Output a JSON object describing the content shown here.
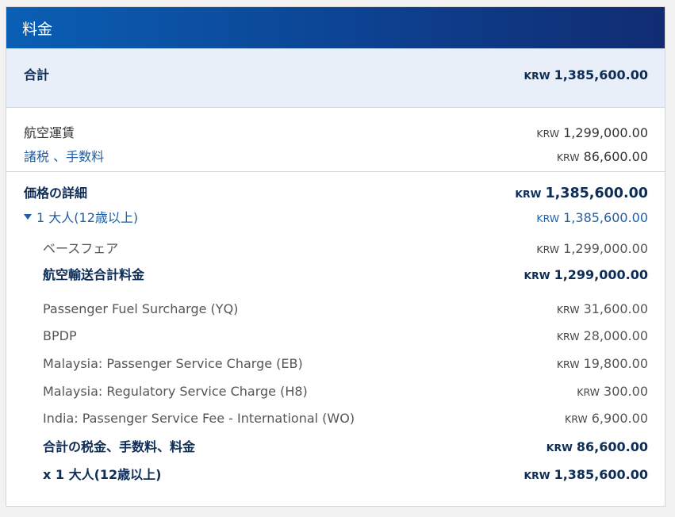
{
  "header": {
    "title": "料金"
  },
  "total": {
    "label": "合計",
    "currency": "KRW",
    "amount": "1,385,600.00"
  },
  "summary": [
    {
      "label": "航空運賃",
      "currency": "KRW",
      "amount": "1,299,000.00"
    },
    {
      "label": "諸税 、手数料",
      "currency": "KRW",
      "amount": "86,600.00"
    }
  ],
  "details": {
    "heading": {
      "label": "価格の詳細",
      "currency": "KRW",
      "amount": "1,385,600.00"
    },
    "passenger": {
      "label": "1 大人(12歳以上)",
      "currency": "KRW",
      "amount": "1,385,600.00"
    },
    "base_fare": {
      "label": "ベースフェア",
      "currency": "KRW",
      "amount": "1,299,000.00"
    },
    "air_total": {
      "label": "航空輸送合計料金",
      "currency": "KRW",
      "amount": "1,299,000.00"
    },
    "taxes": [
      {
        "label": "Passenger Fuel Surcharge (YQ)",
        "currency": "KRW",
        "amount": "31,600.00"
      },
      {
        "label": "BPDP",
        "currency": "KRW",
        "amount": "28,000.00"
      },
      {
        "label": "Malaysia: Passenger Service Charge (EB)",
        "currency": "KRW",
        "amount": "19,800.00"
      },
      {
        "label": "Malaysia: Regulatory Service Charge (H8)",
        "currency": "KRW",
        "amount": "300.00"
      },
      {
        "label": "India: Passenger Service Fee - International (WO)",
        "currency": "KRW",
        "amount": "6,900.00"
      }
    ],
    "tax_total": {
      "label": "合計の税金、手数料、料金",
      "currency": "KRW",
      "amount": "86,600.00"
    },
    "multiplier": {
      "label": "x 1 大人(12歳以上)",
      "currency": "KRW",
      "amount": "1,385,600.00"
    }
  }
}
